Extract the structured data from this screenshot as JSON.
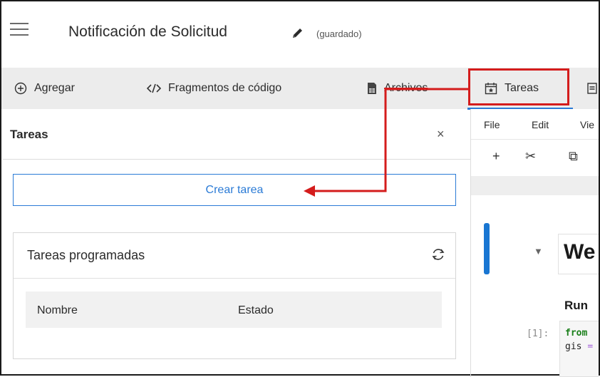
{
  "header": {
    "title": "Notificación de Solicitud",
    "status": "(guardado)"
  },
  "toolbar": {
    "add_label": "Agregar",
    "snippets_label": "Fragmentos de código",
    "files_label": "Archivos",
    "tasks_label": "Tareas"
  },
  "panel": {
    "title": "Tareas",
    "close_symbol": "×",
    "create_button": "Crear tarea",
    "scheduled": {
      "title": "Tareas programadas",
      "columns": [
        "Nombre",
        "Estado"
      ]
    }
  },
  "notebook": {
    "menu": [
      "File",
      "Edit",
      "Vie"
    ],
    "tools": {
      "add": "+",
      "cut": "✂",
      "copy": "⧉"
    },
    "caret": "▼",
    "heading": "We",
    "run_text": "Run",
    "prompt": "[1]:",
    "code_line1": "from",
    "code_line2_var": "gis",
    "code_line2_op": "="
  },
  "colors": {
    "accent": "#2b7bd6",
    "annotation": "#d41c1c",
    "cell_bar": "#1976d2"
  }
}
